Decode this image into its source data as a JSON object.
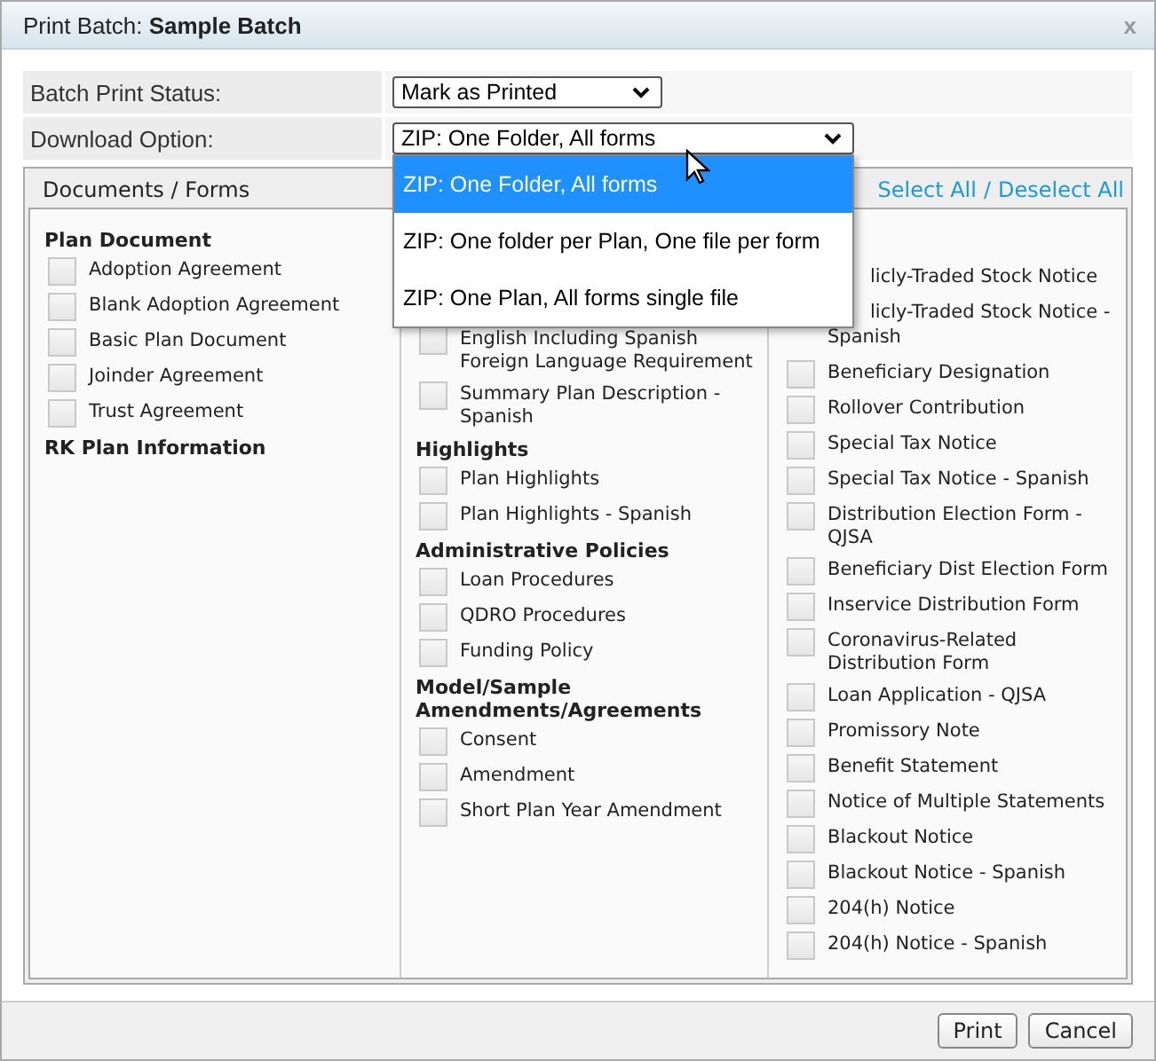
{
  "dialog": {
    "title_label": "Print Batch:",
    "title_name": "Sample Batch",
    "close": "x"
  },
  "fields": [
    {
      "label": "Batch Print Status:",
      "value": "Mark as Printed",
      "open": false
    },
    {
      "label": "Download Option:",
      "value": "ZIP: One Folder, All forms",
      "open": true
    }
  ],
  "dropdown_options": [
    {
      "label": "ZIP: One Folder, All forms",
      "selected": true
    },
    {
      "label": "ZIP: One folder per Plan, One file per form",
      "selected": false
    },
    {
      "label": "ZIP: One Plan, All forms single file",
      "selected": false
    }
  ],
  "documents": {
    "title": "Documents / Forms",
    "select_all": "Select All",
    "separator": "/",
    "deselect_all": "Deselect All",
    "columns": [
      [
        {
          "kind": "heading",
          "label": "Plan Document"
        },
        {
          "kind": "checkbox",
          "label": "Adoption Agreement",
          "checked": false
        },
        {
          "kind": "checkbox",
          "label": "Blank Adoption Agreement",
          "checked": false
        },
        {
          "kind": "checkbox",
          "label": "Basic Plan Document",
          "checked": false
        },
        {
          "kind": "checkbox",
          "label": "Joinder Agreement",
          "checked": false
        },
        {
          "kind": "checkbox",
          "label": "Trust Agreement",
          "checked": false
        },
        {
          "kind": "heading",
          "label": "RK Plan Information"
        }
      ],
      [
        {
          "kind": "checkbox",
          "label": "English Including Spanish Foreign Language Requirement",
          "checked": false
        },
        {
          "kind": "checkbox",
          "label": "Summary Plan Description - Spanish",
          "checked": false
        },
        {
          "kind": "heading",
          "label": "Highlights"
        },
        {
          "kind": "checkbox",
          "label": "Plan Highlights",
          "checked": false
        },
        {
          "kind": "checkbox",
          "label": "Plan Highlights - Spanish",
          "checked": false
        },
        {
          "kind": "heading",
          "label": "Administrative Policies"
        },
        {
          "kind": "checkbox",
          "label": "Loan Procedures",
          "checked": false
        },
        {
          "kind": "checkbox",
          "label": "QDRO Procedures",
          "checked": false
        },
        {
          "kind": "checkbox",
          "label": "Funding Policy",
          "checked": false
        },
        {
          "kind": "heading",
          "label": "Model/Sample Amendments/Agreements"
        },
        {
          "kind": "checkbox",
          "label": "Consent",
          "checked": false
        },
        {
          "kind": "checkbox",
          "label": "Amendment",
          "checked": false
        },
        {
          "kind": "checkbox",
          "label": "Short Plan Year Amendment",
          "checked": false
        }
      ],
      [
        {
          "kind": "clipped",
          "label": "licly-Traded Stock Notice"
        },
        {
          "kind": "clipped",
          "label": "licly-Traded Stock Notice -"
        },
        {
          "kind": "checkbox-tail",
          "label": "Spanish"
        },
        {
          "kind": "checkbox",
          "label": "Beneficiary Designation",
          "checked": false
        },
        {
          "kind": "checkbox",
          "label": "Rollover Contribution",
          "checked": false
        },
        {
          "kind": "checkbox",
          "label": "Special Tax Notice",
          "checked": false
        },
        {
          "kind": "checkbox",
          "label": "Special Tax Notice - Spanish",
          "checked": false
        },
        {
          "kind": "checkbox",
          "label": "Distribution Election Form - QJSA",
          "checked": false
        },
        {
          "kind": "checkbox",
          "label": "Beneficiary Dist Election Form",
          "checked": false
        },
        {
          "kind": "checkbox",
          "label": "Inservice Distribution Form",
          "checked": false
        },
        {
          "kind": "checkbox",
          "label": "Coronavirus-Related Distribution Form",
          "checked": false
        },
        {
          "kind": "checkbox",
          "label": "Loan Application - QJSA",
          "checked": false
        },
        {
          "kind": "checkbox",
          "label": "Promissory Note",
          "checked": false
        },
        {
          "kind": "checkbox",
          "label": "Benefit Statement",
          "checked": false
        },
        {
          "kind": "checkbox",
          "label": "Notice of Multiple Statements",
          "checked": false
        },
        {
          "kind": "checkbox",
          "label": "Blackout Notice",
          "checked": false
        },
        {
          "kind": "checkbox",
          "label": "Blackout Notice - Spanish",
          "checked": false
        },
        {
          "kind": "checkbox",
          "label": "204(h) Notice",
          "checked": false
        },
        {
          "kind": "checkbox",
          "label": "204(h) Notice - Spanish",
          "checked": false
        }
      ]
    ]
  },
  "buttons": [
    "Print",
    "Cancel"
  ]
}
